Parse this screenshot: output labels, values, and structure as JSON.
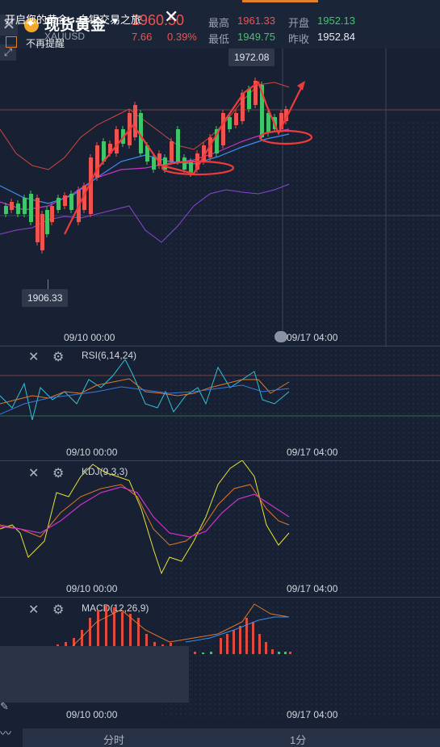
{
  "header": {
    "title": "现货黄金",
    "symbol": "XAUUSD",
    "price": "1960.50",
    "change": "7.66",
    "change_pct": "0.39%",
    "high_label": "最高",
    "high": "1961.33",
    "low_label": "最低",
    "low": "1949.75",
    "open_label": "开盘",
    "open": "1952.13",
    "prev_label": "昨收",
    "prev": "1952.84"
  },
  "main_chart": {
    "high_marker": "1972.08",
    "low_marker": "1906.33",
    "time_left": "09/10 00:00",
    "time_right": "09/17 04:00"
  },
  "rsi": {
    "title": "RSI(6,14,24)",
    "time_left": "09/10 00:00",
    "time_right": "09/17 04:00"
  },
  "kdj": {
    "title": "KDJ(9,3,3)",
    "time_left": "09/10 00:00",
    "time_right": "09/17 04:00"
  },
  "macd": {
    "title": "MACD(12,26,9)",
    "time_left": "09/10 00:00",
    "time_right": "09/17 04:00"
  },
  "popup": {
    "text": "开启您的黄金、白银交易之旅",
    "checkbox_label": "不再提醒"
  },
  "bottom_bar": {
    "left_label": "分时",
    "right_label": "1分"
  },
  "colors": {
    "up": "#ef5350",
    "down": "#41c56a",
    "accent": "#e3812b",
    "background": "#172133"
  },
  "icons": [
    "close-icon",
    "gold-coin-icon",
    "caret-down-icon",
    "expand-icon",
    "settings-icon",
    "chart-line-icon"
  ]
}
